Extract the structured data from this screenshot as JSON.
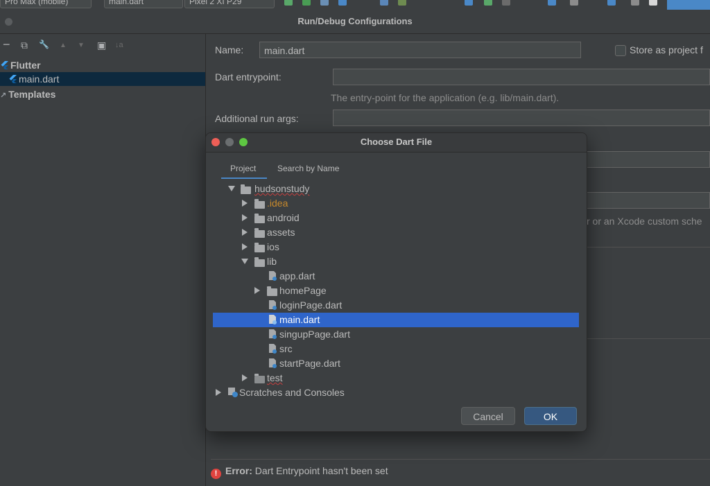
{
  "ide_toolbar": {
    "device_combo": "Pro Max (mobile)",
    "config_combo": "main.dart",
    "pixel_combo": "Pixel 2 XI P29"
  },
  "window": {
    "title": "Run/Debug Configurations"
  },
  "left_panel": {
    "toolbar": {
      "remove": "−",
      "copy": "⧉",
      "settings": "🔧",
      "up": "▲",
      "down": "▼",
      "folder": "▣",
      "sort": "↓a"
    },
    "tree": {
      "group": "Flutter",
      "config": "main.dart",
      "templates": "Templates"
    }
  },
  "form": {
    "name_label": "Name:",
    "name_value": "main.dart",
    "store_label": "Store as project f",
    "entrypoint_label": "Dart entrypoint:",
    "entrypoint_value": "",
    "entrypoint_hint": "The entry-point for the application (e.g. lib/main.dart).",
    "args_label": "Additional run args:",
    "args_value": "",
    "partial_hint": "r or an Xcode custom sche"
  },
  "dialog": {
    "title": "Choose Dart File",
    "tabs": [
      "Project",
      "Search by Name"
    ],
    "tree": {
      "root": "hudsonstudy",
      "idea": ".idea",
      "android": "android",
      "assets": "assets",
      "ios": "ios",
      "lib": "lib",
      "app": "app.dart",
      "homePage": "homePage",
      "loginPage": "loginPage.dart",
      "main": "main.dart",
      "singupPage": "singupPage.dart",
      "src": "src",
      "startPage": "startPage.dart",
      "test": "test",
      "scratches": "Scratches and Consoles"
    },
    "buttons": {
      "cancel": "Cancel",
      "ok": "OK"
    }
  },
  "error": {
    "prefix": "Error:",
    "message": "Dart Entrypoint hasn't been set"
  },
  "colors": {
    "background": "#3c3f41",
    "selection": "#2f65ca",
    "accent": "#4a88c7",
    "idea_folder": "#c7892c",
    "error": "#e0433f"
  }
}
